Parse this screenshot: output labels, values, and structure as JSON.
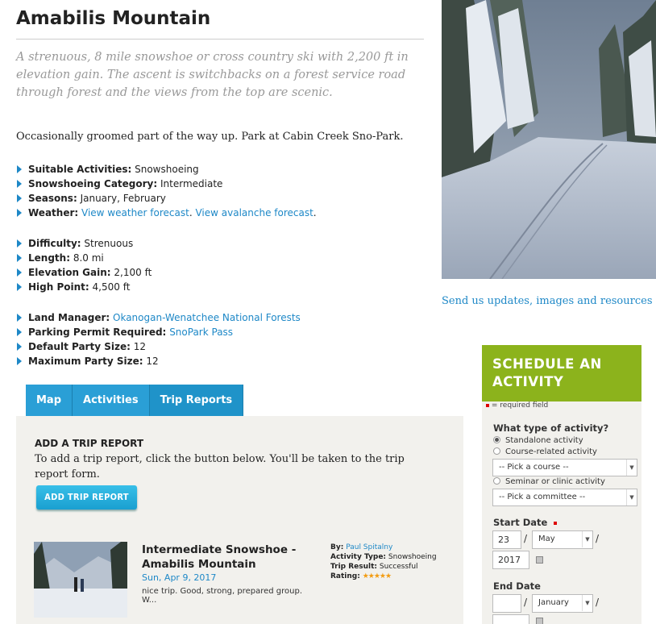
{
  "title": "Amabilis Mountain",
  "lede": "A strenuous, 8 mile snowshoe or cross country ski with 2,200 ft in elevation gain. The ascent is switchbacks on a forest service road through forest and the views from the top are scenic.",
  "note": "Occasionally groomed part of the way up. Park at Cabin Creek Sno-Park.",
  "details1": {
    "activities_label": "Suitable Activities:",
    "activities_value": "Snowshoeing",
    "category_label": "Snowshoeing Category:",
    "category_value": "Intermediate",
    "seasons_label": "Seasons:",
    "seasons_value": "January, February",
    "weather_label": "Weather:",
    "weather_link": "View weather forecast",
    "avalanche_link": "View avalanche forecast"
  },
  "details2": {
    "difficulty_label": "Difficulty:",
    "difficulty_value": "Strenuous",
    "length_label": "Length:",
    "length_value": "8.0 mi",
    "gain_label": "Elevation Gain:",
    "gain_value": "2,100 ft",
    "high_label": "High Point:",
    "high_value": "4,500 ft"
  },
  "details3": {
    "manager_label": "Land Manager:",
    "manager_link": "Okanogan-Wenatchee National Forests",
    "permit_label": "Parking Permit Required:",
    "permit_link": "SnoPark Pass",
    "default_party_label": "Default Party Size:",
    "default_party_value": "12",
    "max_party_label": "Maximum Party Size:",
    "max_party_value": "12"
  },
  "send_link": "Send us updates, images and resources",
  "tabs": [
    "Map",
    "Activities",
    "Trip Reports"
  ],
  "panel": {
    "heading": "ADD A TRIP REPORT",
    "text": "To add a trip report, click the button below. You'll be taken to the trip report form.",
    "button": "ADD TRIP REPORT"
  },
  "report": {
    "title": "Intermediate Snowshoe - Amabilis Mountain",
    "date": "Sun, Apr 9, 2017",
    "snippet": "nice trip. Good, strong, prepared group. W...",
    "by_label": "By:",
    "by_value": "Paul Spitalny",
    "type_label": "Activity Type:",
    "type_value": "Snowshoeing",
    "result_label": "Trip Result:",
    "result_value": "Successful",
    "rating_label": "Rating:",
    "rating_stars": "★★★★★"
  },
  "schedule": {
    "heading_line1": "SCHEDULE AN",
    "heading_line2": "ACTIVITY",
    "required_note": "= required field",
    "q_type": "What type of activity?",
    "opt_standalone": "Standalone activity",
    "opt_course": "Course-related activity",
    "course_select": "-- Pick a course --",
    "opt_seminar": "Seminar or clinic activity",
    "committee_select": "-- Pick a committee --",
    "start_label": "Start Date",
    "start_day": "23",
    "start_month": "May",
    "start_year": "2017",
    "end_label": "End Date",
    "end_day": "",
    "end_month": "January",
    "slash": "/"
  },
  "colors": {
    "link": "#1e88c7",
    "tab": "#2a9fd6",
    "schedule_header": "#8cb31c",
    "button": "#1a9fd0"
  }
}
